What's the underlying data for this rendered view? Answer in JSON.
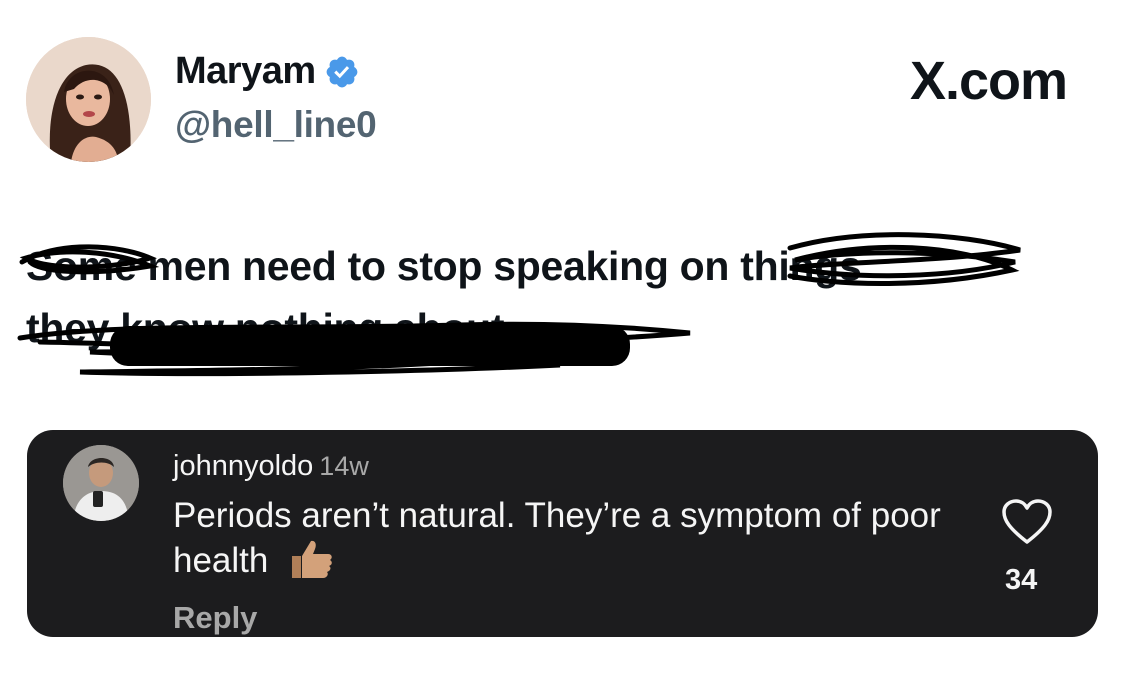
{
  "author": {
    "name": "Maryam",
    "handle": "@hell_line0",
    "verified_icon": "verified-badge-icon",
    "verified_color": "#4a99e9"
  },
  "brand": {
    "text": "X.com"
  },
  "tweet": {
    "line1_struck": "Some",
    "line1_visible": " men need to stop speaking",
    "line1_struck_end": " on things",
    "line2_struck": "they know nothing about..."
  },
  "comment": {
    "username": "johnnyoldo",
    "time": "14w",
    "text": "Periods aren’t natural. They’re a symptom of poor health",
    "emoji_icon": "thumbs-up-icon",
    "reply_label": "Reply",
    "like_icon": "heart-icon",
    "like_count": "34",
    "background": "#1c1c1e"
  }
}
